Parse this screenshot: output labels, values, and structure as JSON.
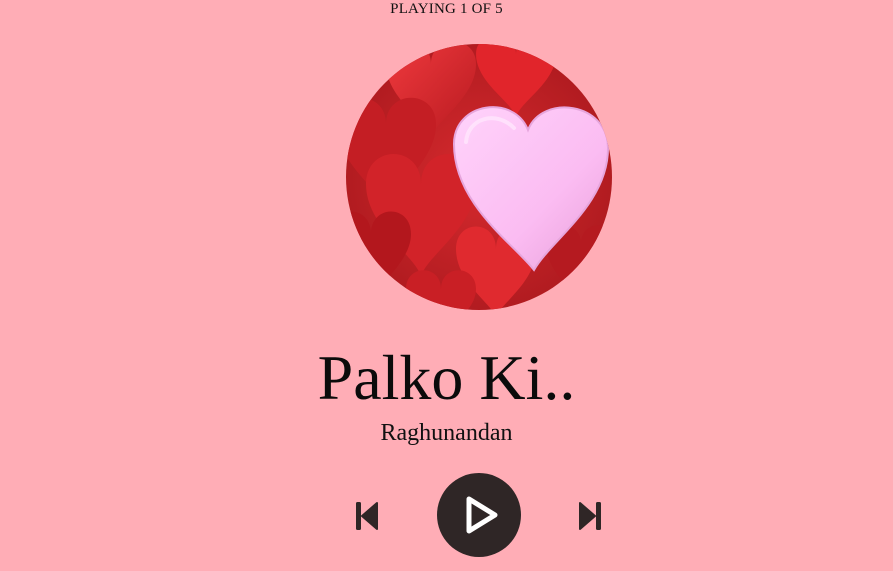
{
  "player": {
    "status_text": "PLAYING 1 OF 5",
    "track": {
      "title": "Palko Ki..",
      "artist": "Raghunandan"
    },
    "controls": {
      "previous_icon": "skip-previous-icon",
      "play_icon": "play-icon",
      "next_icon": "skip-next-icon"
    }
  },
  "colors": {
    "background": "#ffadb6",
    "control_dark": "#2f2626",
    "heart_red": "#d9262c",
    "heart_pink": "#ffc2f4"
  }
}
